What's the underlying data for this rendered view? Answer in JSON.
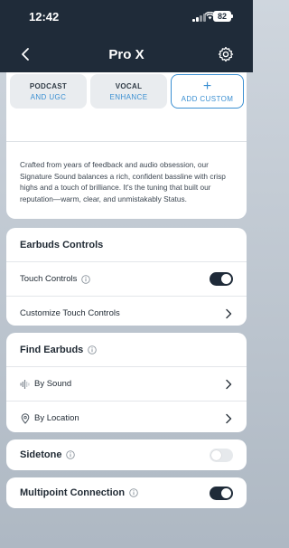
{
  "status_bar": {
    "time": "12:42",
    "battery": "82"
  },
  "header": {
    "title": "Pro X"
  },
  "presets": {
    "chips": [
      {
        "title": "PODCAST",
        "subtitle": "AND UGC"
      },
      {
        "title": "VOCAL",
        "subtitle": "ENHANCE"
      }
    ],
    "add_custom": {
      "plus": "+",
      "label": "ADD CUSTOM"
    },
    "description": "Crafted from years of feedback and audio obsession, our Signature Sound balances a rich, confident bassline with crisp highs and a touch of brilliance. It's the tuning that built our reputation—warm, clear, and unmistakably Status."
  },
  "earbuds_controls": {
    "title": "Earbuds Controls",
    "touch_controls": {
      "label": "Touch Controls",
      "enabled": true
    },
    "customize": {
      "label": "Customize Touch Controls"
    }
  },
  "find_earbuds": {
    "title": "Find Earbuds",
    "by_sound": {
      "label": "By Sound"
    },
    "by_location": {
      "label": "By Location"
    }
  },
  "sidetone": {
    "label": "Sidetone",
    "enabled": false
  },
  "multipoint": {
    "label": "Multipoint Connection",
    "enabled": true
  },
  "colors": {
    "header": "#1f2b39",
    "accent": "#3a8fd2",
    "toggle_on": "#1f2b39",
    "toggle_off": "#e6e9ec"
  },
  "icons": [
    "back-arrow-icon",
    "settings-gear-icon",
    "info-icon",
    "chevron-right-icon",
    "sound-wave-icon",
    "location-pin-icon",
    "signal-icon",
    "wifi-icon",
    "battery-icon"
  ]
}
